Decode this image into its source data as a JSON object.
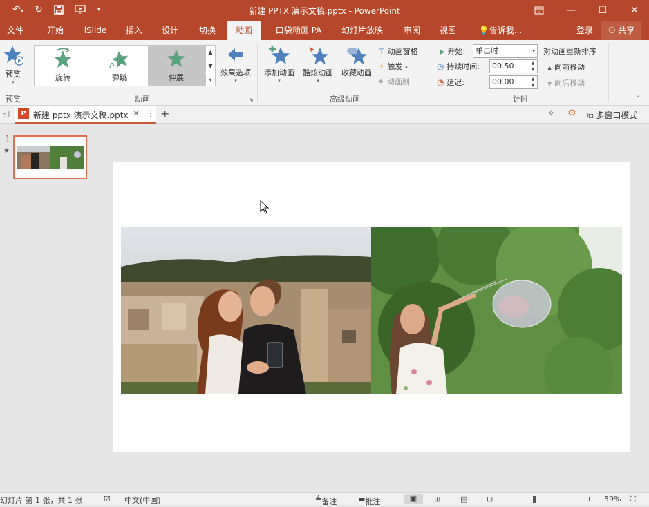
{
  "window": {
    "title": "新建 PPTX 演示文稿.pptx - PowerPoint"
  },
  "tabs": [
    "文件",
    "开始",
    "iSlide",
    "插入",
    "设计",
    "切换",
    "动画",
    "口袋动画 PA",
    "幻灯片放映",
    "审阅",
    "视图"
  ],
  "tell_me": "告诉我...",
  "login": "登录",
  "share": "共享",
  "ribbon": {
    "preview": {
      "label": "预览",
      "group": "预览"
    },
    "animation_group": "动画",
    "gallery": [
      "旋转",
      "弹跳",
      "伸展"
    ],
    "effect_options": "效果选项",
    "advanced": {
      "group": "高级动画",
      "add": "添加动画",
      "cool": "酷炫动画",
      "favorite": "收藏动画",
      "pane": "动画窗格",
      "trigger": "触发",
      "painter": "动画刷"
    },
    "timing": {
      "group": "计时",
      "start_label": "开始:",
      "start_value": "单击时",
      "duration_label": "持续时间:",
      "duration_value": "00.50",
      "delay_label": "延迟:",
      "delay_value": "00.00"
    },
    "reorder": {
      "title": "对动画重新排序",
      "forward": "向前移动",
      "backward": "向后移动"
    }
  },
  "docbar": {
    "tab_name": "新建 pptx 演示文稿.pptx",
    "multiwindow": "多窗口模式"
  },
  "thumbnails": [
    {
      "number": "1",
      "star": "★"
    }
  ],
  "status": {
    "slide_info": "幻灯片 第 1 张，共 1 张",
    "language": "中文(中国)",
    "notes": "备注",
    "comments": "批注",
    "zoom": "59%"
  },
  "colors": {
    "accent": "#b7472a",
    "ribbon_bg": "#f3f3f3",
    "star_blue": "#4f81bd",
    "star_green": "#5aa37e"
  }
}
